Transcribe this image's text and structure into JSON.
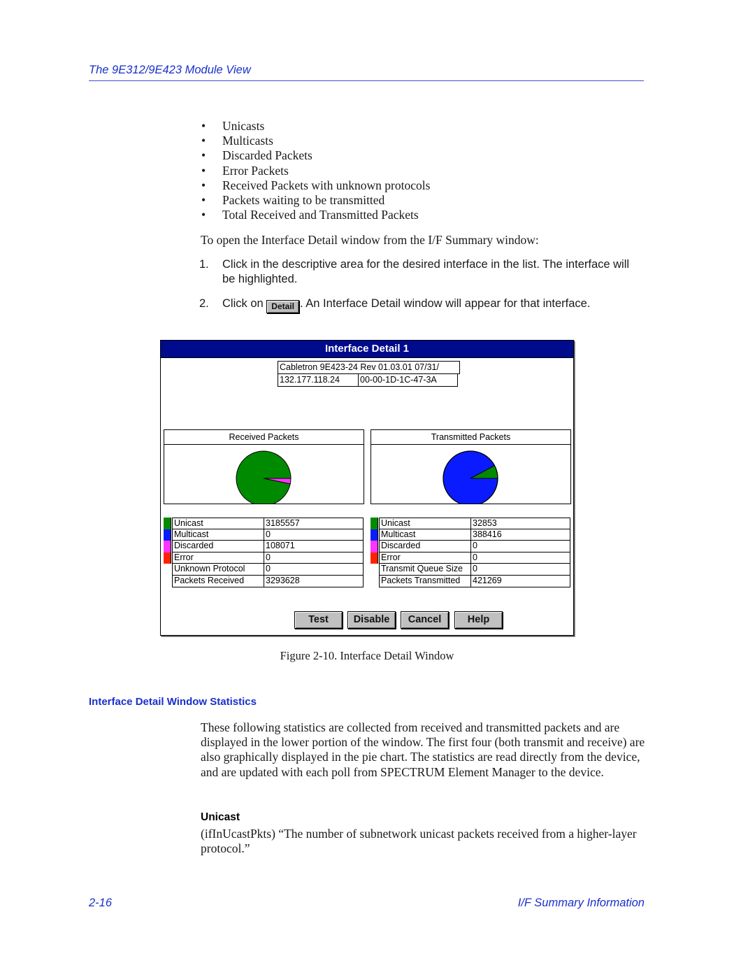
{
  "header": {
    "running_title": "The 9E312/9E423 Module View"
  },
  "bullets": [
    "Unicasts",
    "Multicasts",
    "Discarded Packets",
    "Error Packets",
    "Received Packets with unknown protocols",
    "Packets waiting to be transmitted",
    "Total Received and Transmitted Packets"
  ],
  "bullet_glyph": "•",
  "intro": "To open the Interface Detail window from the I/F Summary window:",
  "steps": [
    {
      "num": "1.",
      "text": "Click in the descriptive area for the desired interface in the list. The interface will be highlighted."
    },
    {
      "num": "2.",
      "prefix": "Click on ",
      "button": "Detail",
      "suffix": ". An Interface Detail window will appear for that interface."
    }
  ],
  "window": {
    "title": "Interface Detail 1",
    "device_description": "Cabletron 9E423-24 Rev 01.03.01  07/31/",
    "ip_address": "132.177.118.24",
    "mac_address": "00-00-1D-1C-47-3A",
    "colors": {
      "unicast": "#008a00",
      "multicast": "#0a1cff",
      "discarded": "#ff33ff",
      "error": "#ff2200",
      "titlebar": "#000a8c"
    },
    "received": {
      "title": "Received Packets",
      "rows": [
        {
          "label": "Unicast",
          "value": "3185557",
          "swatch": "unicast"
        },
        {
          "label": "Multicast",
          "value": "0",
          "swatch": "multicast"
        },
        {
          "label": "Discarded",
          "value": "108071",
          "swatch": "discarded"
        },
        {
          "label": "Error",
          "value": "0",
          "swatch": "error"
        },
        {
          "label": "Unknown Protocol",
          "value": "0",
          "swatch": ""
        },
        {
          "label": "Packets Received",
          "value": "3293628",
          "swatch": ""
        }
      ]
    },
    "transmitted": {
      "title": "Transmitted Packets",
      "rows": [
        {
          "label": "Unicast",
          "value": "32853",
          "swatch": "unicast"
        },
        {
          "label": "Multicast",
          "value": "388416",
          "swatch": "multicast"
        },
        {
          "label": "Discarded",
          "value": "0",
          "swatch": "discarded"
        },
        {
          "label": "Error",
          "value": "0",
          "swatch": "error"
        },
        {
          "label": "Transmit Queue Size",
          "value": "0",
          "swatch": ""
        },
        {
          "label": "Packets Transmitted",
          "value": "421269",
          "swatch": ""
        }
      ]
    },
    "buttons": [
      "Test",
      "Disable",
      "Cancel",
      "Help"
    ]
  },
  "chart_data": [
    {
      "type": "pie",
      "title": "Received Packets",
      "categories": [
        "Unicast",
        "Multicast",
        "Discarded",
        "Error"
      ],
      "values": [
        3185557,
        0,
        108071,
        0
      ],
      "colors": [
        "#008a00",
        "#0a1cff",
        "#ff33ff",
        "#ff2200"
      ]
    },
    {
      "type": "pie",
      "title": "Transmitted Packets",
      "categories": [
        "Unicast",
        "Multicast",
        "Discarded",
        "Error"
      ],
      "values": [
        32853,
        388416,
        0,
        0
      ],
      "colors": [
        "#008a00",
        "#0a1cff",
        "#ff33ff",
        "#ff2200"
      ]
    }
  ],
  "figure_caption": "Figure 2-10.  Interface Detail Window",
  "section": {
    "heading": "Interface Detail Window Statistics",
    "paragraph": "These following statistics are collected from received and transmitted packets and are displayed in the lower portion of the window. The first four (both transmit and receive) are also graphically displayed in the pie chart. The statistics are read directly from the device, and are updated with each poll from SPECTRUM Element Manager to the device.",
    "subheading": "Unicast",
    "subparagraph": "(ifInUcastPkts) “The number of subnetwork unicast packets received from a higher-layer protocol.”"
  },
  "footer": {
    "page_number": "2-16",
    "section_title": "I/F Summary Information"
  }
}
